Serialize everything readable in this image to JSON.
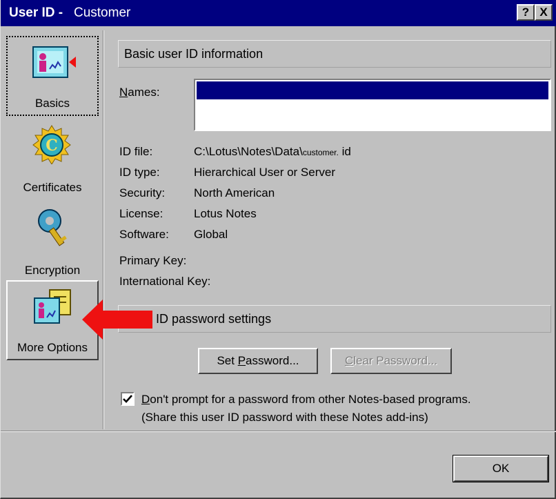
{
  "window": {
    "title_app": "User ID -",
    "title_context": "Customer",
    "help_glyph": "?",
    "close_glyph": "X"
  },
  "sidebar": {
    "items": [
      {
        "label": "Basics",
        "icon": "basics-icon",
        "selected": true
      },
      {
        "label": "Certificates",
        "icon": "certificate-icon"
      },
      {
        "label": "Encryption",
        "icon": "key-icon"
      },
      {
        "label": "More Options",
        "icon": "more-options-icon",
        "pressed": true
      }
    ]
  },
  "basic": {
    "header": "Basic user ID information",
    "names_label_first": "N",
    "names_label_rest": "ames:",
    "rows": [
      {
        "key": "ID file:",
        "value": "C:\\Lotus\\Notes\\Data\\",
        "value_small": "customer.",
        "value_tail": " id"
      },
      {
        "key": "ID type:",
        "value": "Hierarchical User or Server"
      },
      {
        "key": "Security:",
        "value": "North American"
      },
      {
        "key": "License:",
        "value": "Lotus Notes"
      },
      {
        "key": "Software:",
        "value": "Global"
      }
    ],
    "primary_key_label": "Primary Key:",
    "international_key_label": "International Key:"
  },
  "password": {
    "header": "ID password settings",
    "set_button_pre": "Set ",
    "set_button_u": "P",
    "set_button_post": "assword...",
    "clear_button_u": "C",
    "clear_button_post": "lear Password...",
    "checkbox_checked": true,
    "checkbox_u": "D",
    "checkbox_line1_rest": "on't prompt for a password from other Notes-based programs.",
    "checkbox_line2": "(Share this user ID password with these Notes add-ins)"
  },
  "footer": {
    "ok_label": "OK"
  },
  "colors": {
    "titlebar": "#000080",
    "face": "#c0c0c0",
    "annotation_arrow": "#ee1111"
  }
}
